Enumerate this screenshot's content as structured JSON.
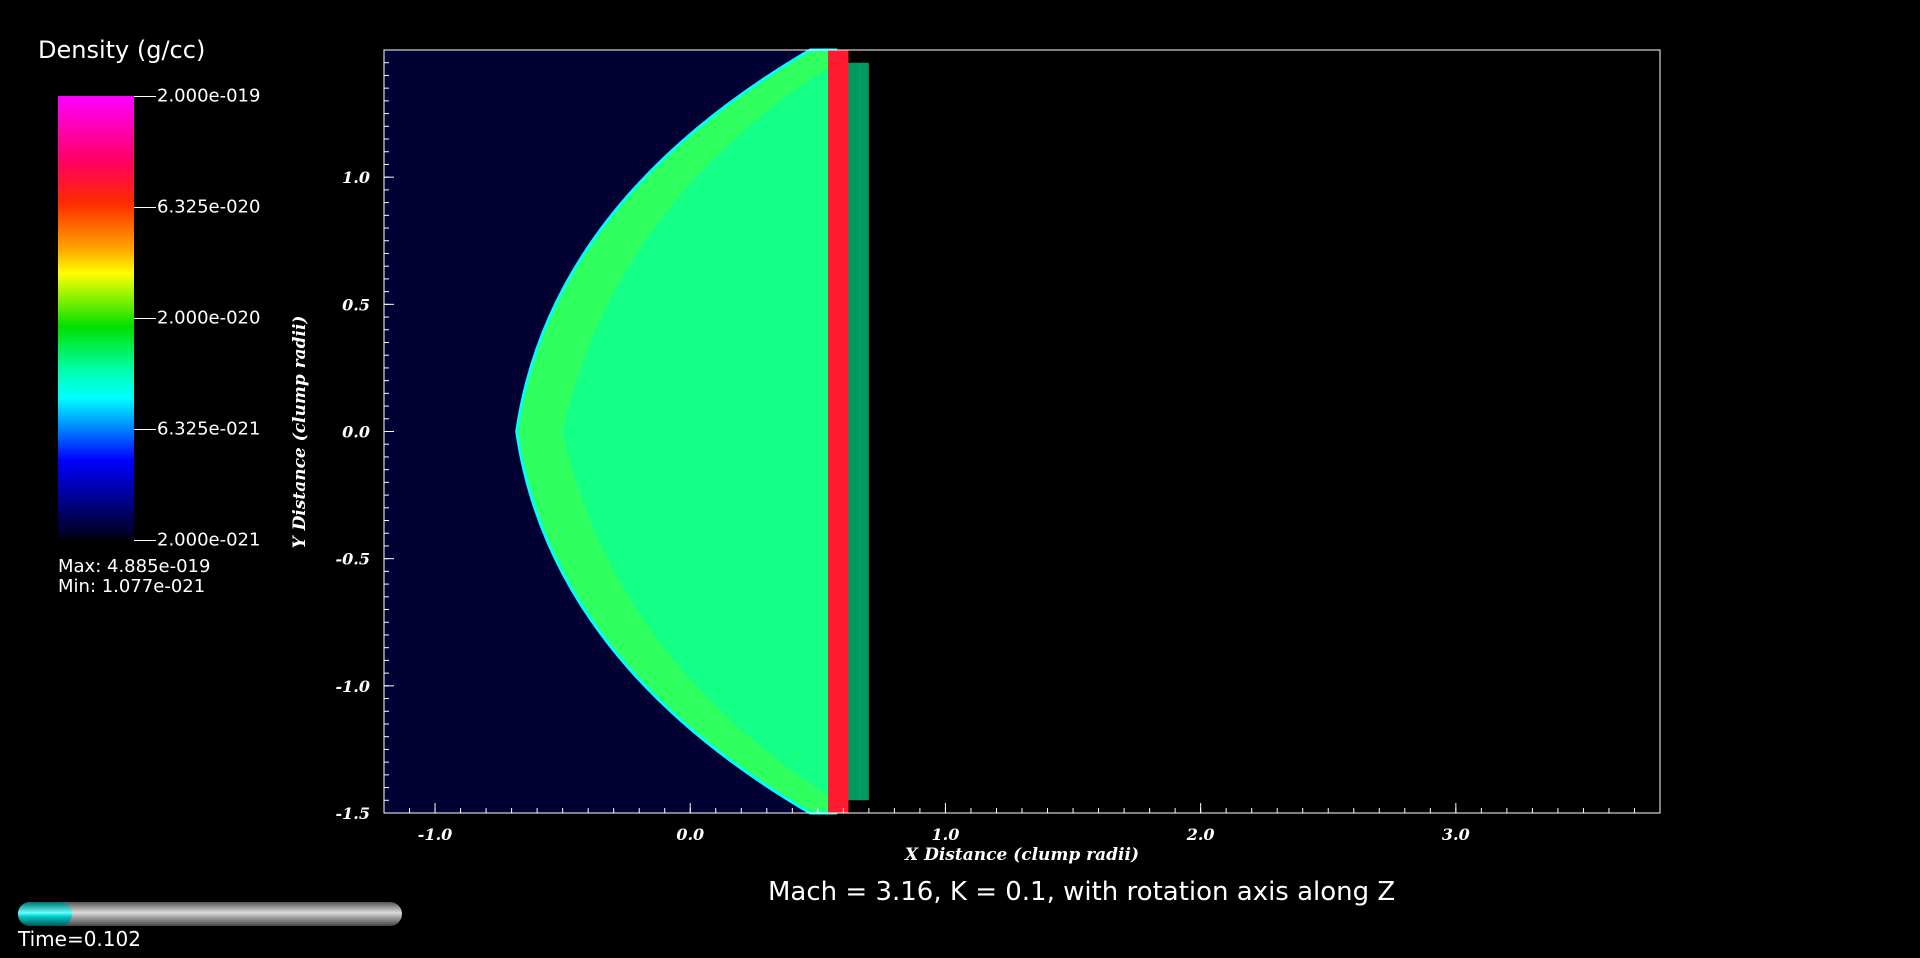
{
  "chart_data": {
    "type": "heatmap",
    "title": "Mach = 3.16, K = 0.1, with rotation axis along Z",
    "xlabel": "X Distance (clump radii)",
    "ylabel": "Y Distance (clump radii)",
    "xlim": [
      -1.2,
      3.8
    ],
    "ylim": [
      -1.5,
      1.5
    ],
    "x_ticks": [
      "-1.0",
      "0.0",
      "1.0",
      "2.0",
      "3.0"
    ],
    "x_tick_values": [
      -1.0,
      0.0,
      1.0,
      2.0,
      3.0
    ],
    "y_ticks": [
      "1.0",
      "0.5",
      "0.0",
      "-0.5",
      "-1.0",
      "-1.5"
    ],
    "y_tick_values": [
      1.0,
      0.5,
      0.0,
      -0.5,
      -1.0,
      -1.5
    ],
    "colorbar": {
      "title": "Density (g/cc)",
      "labels": [
        "2.000e-019",
        "6.325e-020",
        "2.000e-020",
        "6.325e-021",
        "2.000e-021"
      ],
      "fractions": [
        0.0,
        0.25,
        0.5,
        0.75,
        1.0
      ],
      "max_text": "Max:  4.885e-019",
      "min_text": "Min:  1.077e-021",
      "scale": "log"
    },
    "background_color": "#000033"
  },
  "time": {
    "label": "Time=0.102",
    "progress": 0.14
  }
}
